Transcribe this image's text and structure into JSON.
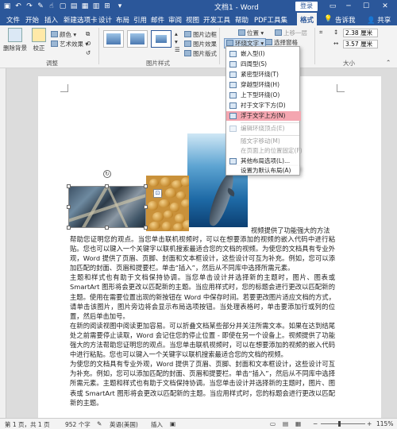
{
  "titlebar": {
    "doc_title": "文档1 - Word",
    "login": "登录"
  },
  "tabs": [
    "文件",
    "开始",
    "插入",
    "新建选项卡",
    "设计",
    "布局",
    "引用",
    "邮件",
    "审阅",
    "视图",
    "开发工具",
    "帮助",
    "PDF工具集",
    "格式"
  ],
  "active_tab": "格式",
  "tab_extra": {
    "tell_me": "告诉我",
    "share": "共享"
  },
  "ribbon": {
    "remove_bg": "删除背景",
    "correct": "校正",
    "color": "颜色",
    "artistic": "艺术效果",
    "group_adjust": "调整",
    "pic_border": "图片边框",
    "pic_effects": "图片效果",
    "pic_layout": "图片版式",
    "group_styles": "图片样式",
    "position": "位置",
    "wrap_text": "环绕文字",
    "bring_forward": "上移一层",
    "selection_pane": "选择窗格",
    "group_size": "大小",
    "height_value": "2.38 厘米",
    "width_value": "3.57 厘米"
  },
  "wrap_menu": {
    "items": [
      {
        "label": "嵌入型(I)",
        "disabled": false,
        "highlight": false
      },
      {
        "label": "四周型(S)",
        "disabled": false,
        "highlight": false
      },
      {
        "label": "紧密型环绕(T)",
        "disabled": false,
        "highlight": false
      },
      {
        "label": "穿越型环绕(H)",
        "disabled": false,
        "highlight": false
      },
      {
        "label": "上下型环绕(O)",
        "disabled": false,
        "highlight": false
      },
      {
        "label": "衬于文字下方(D)",
        "disabled": false,
        "highlight": false
      },
      {
        "label": "浮于文字上方(N)",
        "disabled": false,
        "highlight": true
      },
      {
        "label": "编辑环绕顶点(E)",
        "disabled": true,
        "highlight": false
      },
      {
        "label": "随文字移动(M)",
        "disabled": true,
        "highlight": false
      },
      {
        "label": "在页面上的位置固定(F)",
        "disabled": true,
        "highlight": false
      },
      {
        "label": "其他布局选项(L)...",
        "disabled": false,
        "highlight": false
      },
      {
        "label": "设置为默认布局(A)",
        "disabled": false,
        "highlight": false
      }
    ]
  },
  "document": {
    "first_line_tail": "视频提供了功能强大的方法",
    "paragraphs": [
      "帮助您证明您的观点。当您单击联机视频时，可以在想要添加的视频的嵌入代码中进行粘贴。您也可以键入一个关键字以联机搜索最适合您的文档的视频。为使您的文档具有专业外观，Word 提供了页眉、页脚、封面和文本框设计，这些设计可互为补充。例如，您可以添加匹配的封面、页眉和提要栏。单击“插入”，然后从不同库中选择所需元素。",
      "主题和样式也有助于文档保持协调。当您单击设计并选择新的主题时，图片、图表或 SmartArt 图形将会更改以匹配新的主题。当应用样式时，您的标题会进行更改以匹配新的主题。使用在需要位置出现的新按钮在 Word 中保存时间。若要更改图片适应文档的方式，请单击该图片，图片旁边将会显示布局选项按钮。当处理表格时，单击要添加行或列的位置，然后单击加号。",
      "在新的阅读视图中阅读更加容易。可以折叠文档某些部分并关注所需文本。如果在达到结尾处之前需要停止读取，Word 会记住您的停止位置 - 即使在另一个设备上。视频提供了功能强大的方法帮助您证明您的观点。当您单击联机视频时，可以在想要添加的视频的嵌入代码中进行粘贴。您也可以键入一个关键字以联机搜索最适合您的文档的视频。",
      "为使您的文档具有专业外观，Word 提供了页眉、页脚、封面和文本框设计，这些设计可互为补充。例如，您可以添加匹配的封面、页眉和提要栏。单击“插入”，然后从不同库中选择所需元素。主题和样式也有助于文档保持协调。当您单击设计并选择新的主题时，图片、图表或 SmartArt 图形将会更改以匹配新的主题。当应用样式时，您的标题会进行更改以匹配新的主题。"
    ]
  },
  "statusbar": {
    "page": "第 1 页，共 1 页",
    "words": "952 个字",
    "lang": "英语(美国)",
    "mode": "插入",
    "zoom": "115%"
  }
}
